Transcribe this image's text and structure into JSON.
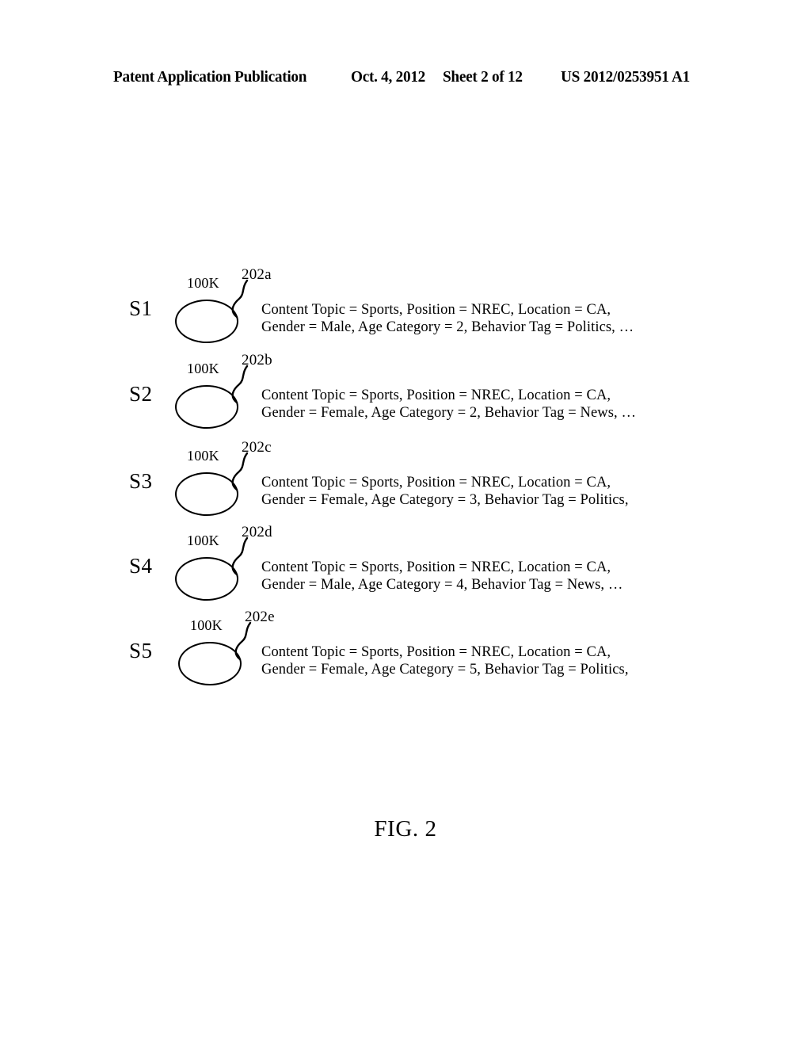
{
  "header": {
    "publication": "Patent Application Publication",
    "date": "Oct. 4, 2012",
    "sheet": "Sheet 2 of 12",
    "patent_number": "US 2012/0253951 A1"
  },
  "figure": {
    "caption": "FIG. 2",
    "rows": [
      {
        "segment_label": "S1",
        "count": "100K",
        "reference": "202a",
        "line1": "Content Topic = Sports, Position = NREC, Location = CA,",
        "line2": "Gender = Male, Age Category = 2, Behavior Tag = Politics, …"
      },
      {
        "segment_label": "S2",
        "count": "100K",
        "reference": "202b",
        "line1": "Content Topic = Sports, Position = NREC, Location = CA,",
        "line2": "Gender = Female, Age Category = 2, Behavior Tag = News, …"
      },
      {
        "segment_label": "S3",
        "count": "100K",
        "reference": "202c",
        "line1": "Content Topic = Sports, Position = NREC, Location = CA,",
        "line2": "Gender = Female, Age Category = 3, Behavior Tag = Politics,"
      },
      {
        "segment_label": "S4",
        "count": "100K",
        "reference": "202d",
        "line1": "Content Topic = Sports, Position = NREC, Location = CA,",
        "line2": "Gender = Male, Age Category = 4, Behavior Tag = News, …"
      },
      {
        "segment_label": "S5",
        "count": "100K",
        "reference": "202e",
        "line1": "Content Topic = Sports, Position = NREC, Location = CA,",
        "line2": "Gender = Female, Age Category = 5, Behavior Tag = Politics,"
      }
    ]
  }
}
